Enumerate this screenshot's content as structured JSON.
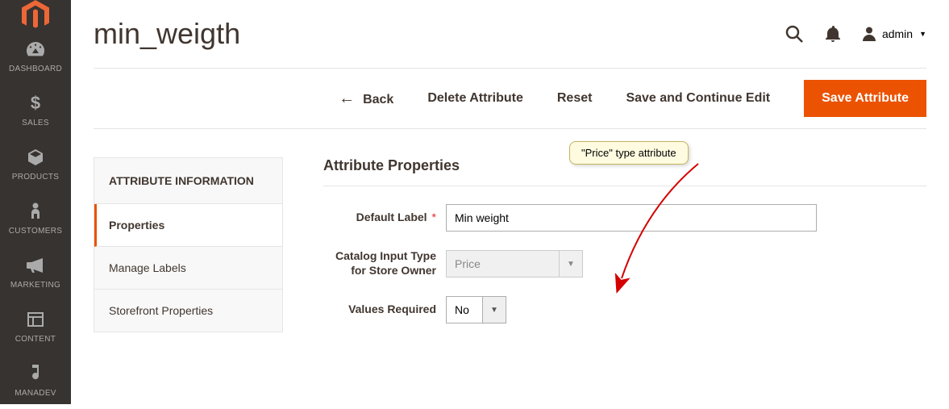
{
  "sidebar": {
    "items": [
      {
        "label": "DASHBOARD"
      },
      {
        "label": "SALES"
      },
      {
        "label": "PRODUCTS"
      },
      {
        "label": "CUSTOMERS"
      },
      {
        "label": "MARKETING"
      },
      {
        "label": "CONTENT"
      },
      {
        "label": "MANADEV"
      }
    ]
  },
  "header": {
    "page_title": "min_weigth",
    "admin_label": "admin"
  },
  "actions": {
    "back": "Back",
    "delete": "Delete Attribute",
    "reset": "Reset",
    "save_continue": "Save and Continue Edit",
    "save": "Save Attribute"
  },
  "left_panel": {
    "title": "ATTRIBUTE INFORMATION",
    "tabs": {
      "properties": "Properties",
      "manage_labels": "Manage Labels",
      "storefront": "Storefront Properties"
    }
  },
  "form": {
    "section_title": "Attribute Properties",
    "default_label_label": "Default Label",
    "default_label_value": "Min weight",
    "catalog_input_type_label": "Catalog Input Type for Store Owner",
    "catalog_input_type_value": "Price",
    "values_required_label": "Values Required",
    "values_required_value": "No"
  },
  "annotation": {
    "callout_text": "\"Price\" type attribute"
  }
}
